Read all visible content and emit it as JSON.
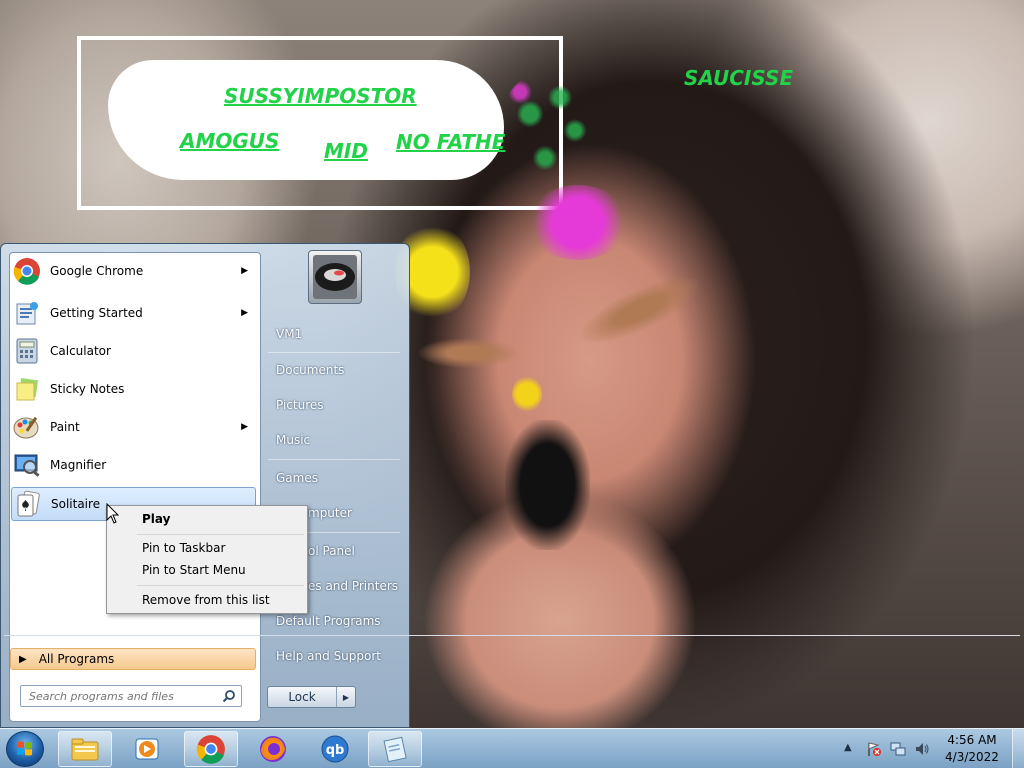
{
  "wallpaper": {
    "meme_texts": [
      "SUSSYIMPOSTOR",
      "AMOGUS",
      "MID",
      "NO FATHE",
      "SAUCISSE"
    ],
    "meme_text_color": "#22d34a"
  },
  "start_menu": {
    "pinned": [
      {
        "label": "Google Chrome",
        "icon": "chrome-icon",
        "has_submenu": true
      },
      {
        "label": "Getting Started",
        "icon": "getting-started-icon",
        "has_submenu": true
      },
      {
        "label": "Calculator",
        "icon": "calculator-icon",
        "has_submenu": false
      },
      {
        "label": "Sticky Notes",
        "icon": "sticky-notes-icon",
        "has_submenu": false
      },
      {
        "label": "Paint",
        "icon": "paint-icon",
        "has_submenu": true
      },
      {
        "label": "Magnifier",
        "icon": "magnifier-icon",
        "has_submenu": false
      },
      {
        "label": "Solitaire",
        "icon": "solitaire-icon",
        "has_submenu": false,
        "highlighted": true
      }
    ],
    "all_programs_label": "All Programs",
    "search_placeholder": "Search programs and files",
    "right_items": [
      "VM1",
      "Documents",
      "Pictures",
      "Music",
      "Games",
      "Computer",
      "Control Panel",
      "Devices and Printers",
      "Default Programs",
      "Help and Support"
    ],
    "right_items_visible": [
      "VM1",
      "Documents",
      "Pictures",
      "Music",
      "Games",
      "mputer",
      "ol Panel",
      "es and Printers",
      "Default Programs",
      "Help and Support"
    ],
    "lock_label": "Lock"
  },
  "context_menu": {
    "items": [
      "Play",
      "Pin to Taskbar",
      "Pin to Start Menu",
      "Remove from this list"
    ],
    "default_item": "Play"
  },
  "taskbar": {
    "buttons": [
      "windows-explorer-icon",
      "media-player-icon",
      "chrome-icon",
      "firefox-icon",
      "qbittorrent-icon",
      "notepad-icon"
    ],
    "clock_time": "4:56 AM",
    "clock_date": "4/3/2022"
  },
  "colors": {
    "accent": "#1e5fa8",
    "all_programs_bg": "#f6c98e",
    "spray_magenta": "#e63ad8",
    "spray_yellow": "#f5e11a",
    "spray_brown": "#b07a55"
  }
}
